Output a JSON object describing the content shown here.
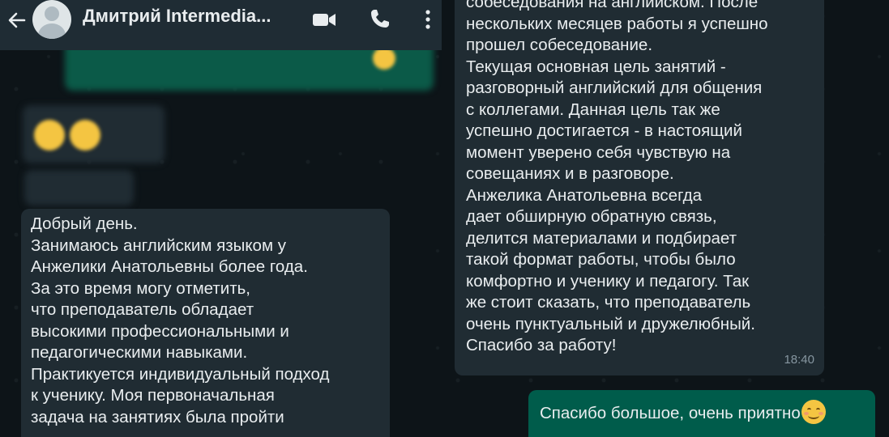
{
  "header": {
    "contact_name": "Дмитрий Intermedia..."
  },
  "left_message": {
    "lines": [
      "Добрый день.",
      "Занимаюсь английским языком у",
      "Анжелики Анатольевны более года.",
      "За это время могу отметить,",
      "что преподаватель обладает",
      "высокими профессиональными и",
      "педагогическими навыками.",
      "Практикуется индивидуальный подход",
      "к ученику. Моя первоначальная",
      "задача на занятиях была пройти"
    ]
  },
  "right_message": {
    "lines": [
      "собеседования на английском. После",
      "нескольких месяцев работы я успешно",
      "прошел собеседование.",
      "Текущая основная цель занятий -",
      "разговорный английский для общения",
      "с коллегами.  Данная цель так же",
      "успешно достигается - в настоящий",
      "момент уверено себя чувствую на",
      "совещаниях и в разговоре.",
      "Анжелика Анатольевна всегда",
      "дает обширную обратную связь,",
      "делится материалами и подбирает",
      "такой формат работы, чтобы было",
      "комфортно и ученику и педагогу. Так",
      "же стоит сказать, что преподаватель",
      "очень пунктуальный и дружелюбный.",
      "Спасибо за работу!"
    ],
    "time": "18:40"
  },
  "reply_message": {
    "text": "Спасибо большое, очень приятно"
  },
  "icons": {
    "back": "arrow-left-icon",
    "avatar": "default-avatar-icon",
    "video": "video-camera-icon",
    "call": "phone-icon",
    "menu": "kebab-menu-icon",
    "emoji": "smiling-face-icon"
  },
  "colors": {
    "header_bg": "#1f2c34",
    "incoming_bubble": "#202c33",
    "outgoing_bubble": "#005c4b",
    "text": "#e9edef",
    "timestamp": "#8696a0"
  }
}
